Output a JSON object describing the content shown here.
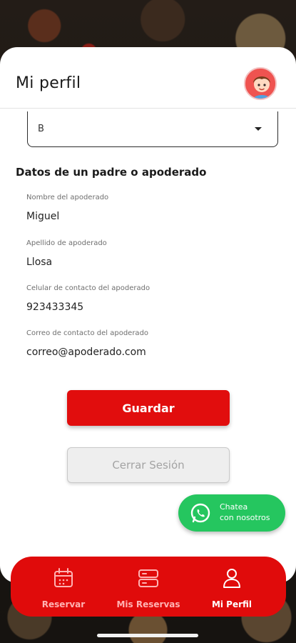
{
  "header": {
    "title": "Mi perfil"
  },
  "select": {
    "value": "B"
  },
  "guardian_section": {
    "title": "Datos de un padre o apoderado",
    "fields": [
      {
        "label": "Nombre del apoderado",
        "value": "Miguel"
      },
      {
        "label": "Apellido de apoderado",
        "value": "Llosa"
      },
      {
        "label": "Celular de contacto del apoderado",
        "value": "923433345"
      },
      {
        "label": "Correo de contacto del apoderado",
        "value": "correo@apoderado.com"
      }
    ]
  },
  "actions": {
    "save_label": "Guardar",
    "logout_label": "Cerrar Sesión"
  },
  "whatsapp": {
    "line1": "Chatea",
    "line2": "con nosotros"
  },
  "nav": {
    "items": [
      {
        "label": "Reservar",
        "icon": "calendar-icon",
        "active": false
      },
      {
        "label": "Mis Reservas",
        "icon": "list-icon",
        "active": false
      },
      {
        "label": "Mi Perfil",
        "icon": "user-icon",
        "active": true
      }
    ]
  },
  "colors": {
    "brand_red": "#e10d0d",
    "whatsapp_green": "#25c65f"
  }
}
